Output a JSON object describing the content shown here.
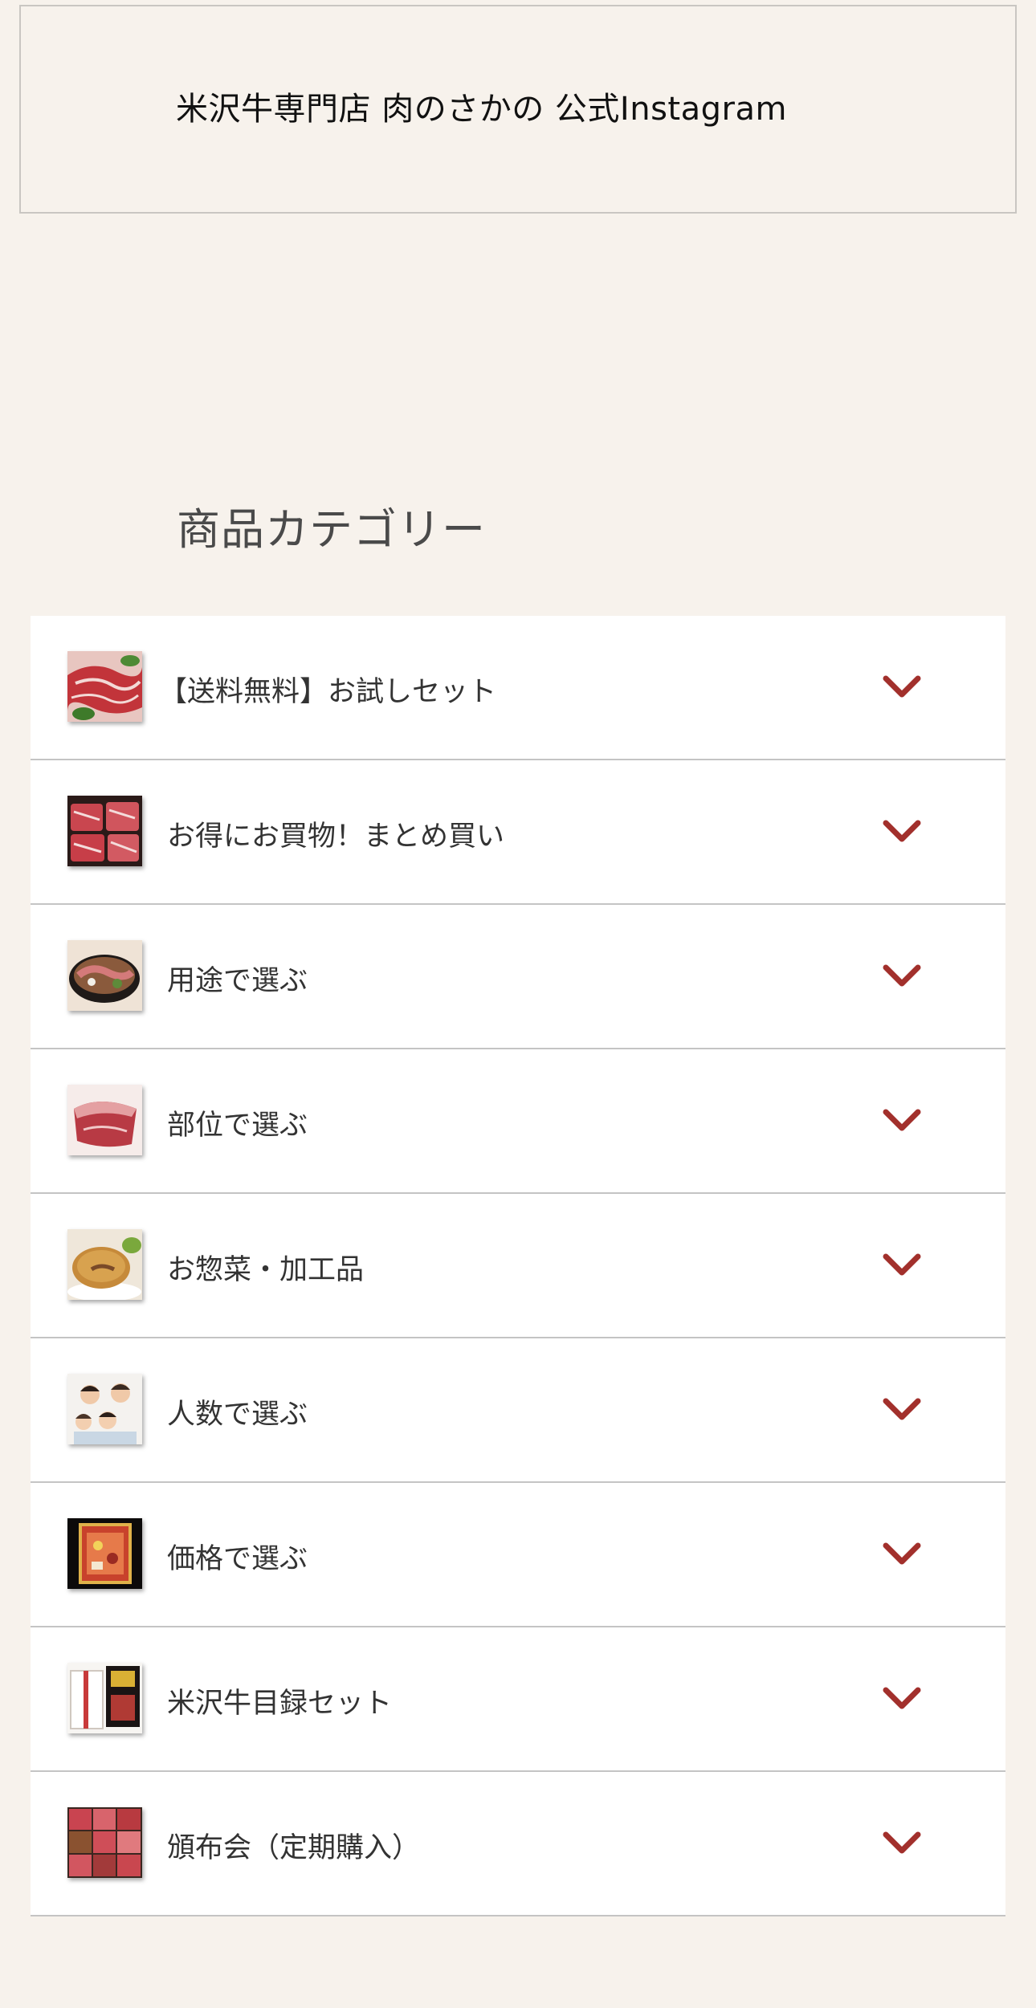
{
  "instagram": {
    "title": "米沢牛専門店 肉のさかの 公式Instagram"
  },
  "categories_section": {
    "title": "商品カテゴリー",
    "accent_color": "#a2302c",
    "items": [
      {
        "label": "【送料無料】お試しセット",
        "icon": "sliced-beef-thumbnail"
      },
      {
        "label": "お得にお買物！まとめ買い",
        "icon": "marbled-beef-thumbnail"
      },
      {
        "label": "用途で選ぶ",
        "icon": "sukiyaki-pot-thumbnail"
      },
      {
        "label": "部位で選ぶ",
        "icon": "beef-cut-thumbnail"
      },
      {
        "label": "お惣菜・加工品",
        "icon": "menchi-katsu-thumbnail"
      },
      {
        "label": "人数で選ぶ",
        "icon": "family-photo-thumbnail"
      },
      {
        "label": "価格で選ぶ",
        "icon": "gift-box-thumbnail"
      },
      {
        "label": "米沢牛目録セット",
        "icon": "gift-catalog-thumbnail"
      },
      {
        "label": "頒布会（定期購入）",
        "icon": "beef-collage-thumbnail"
      }
    ]
  }
}
